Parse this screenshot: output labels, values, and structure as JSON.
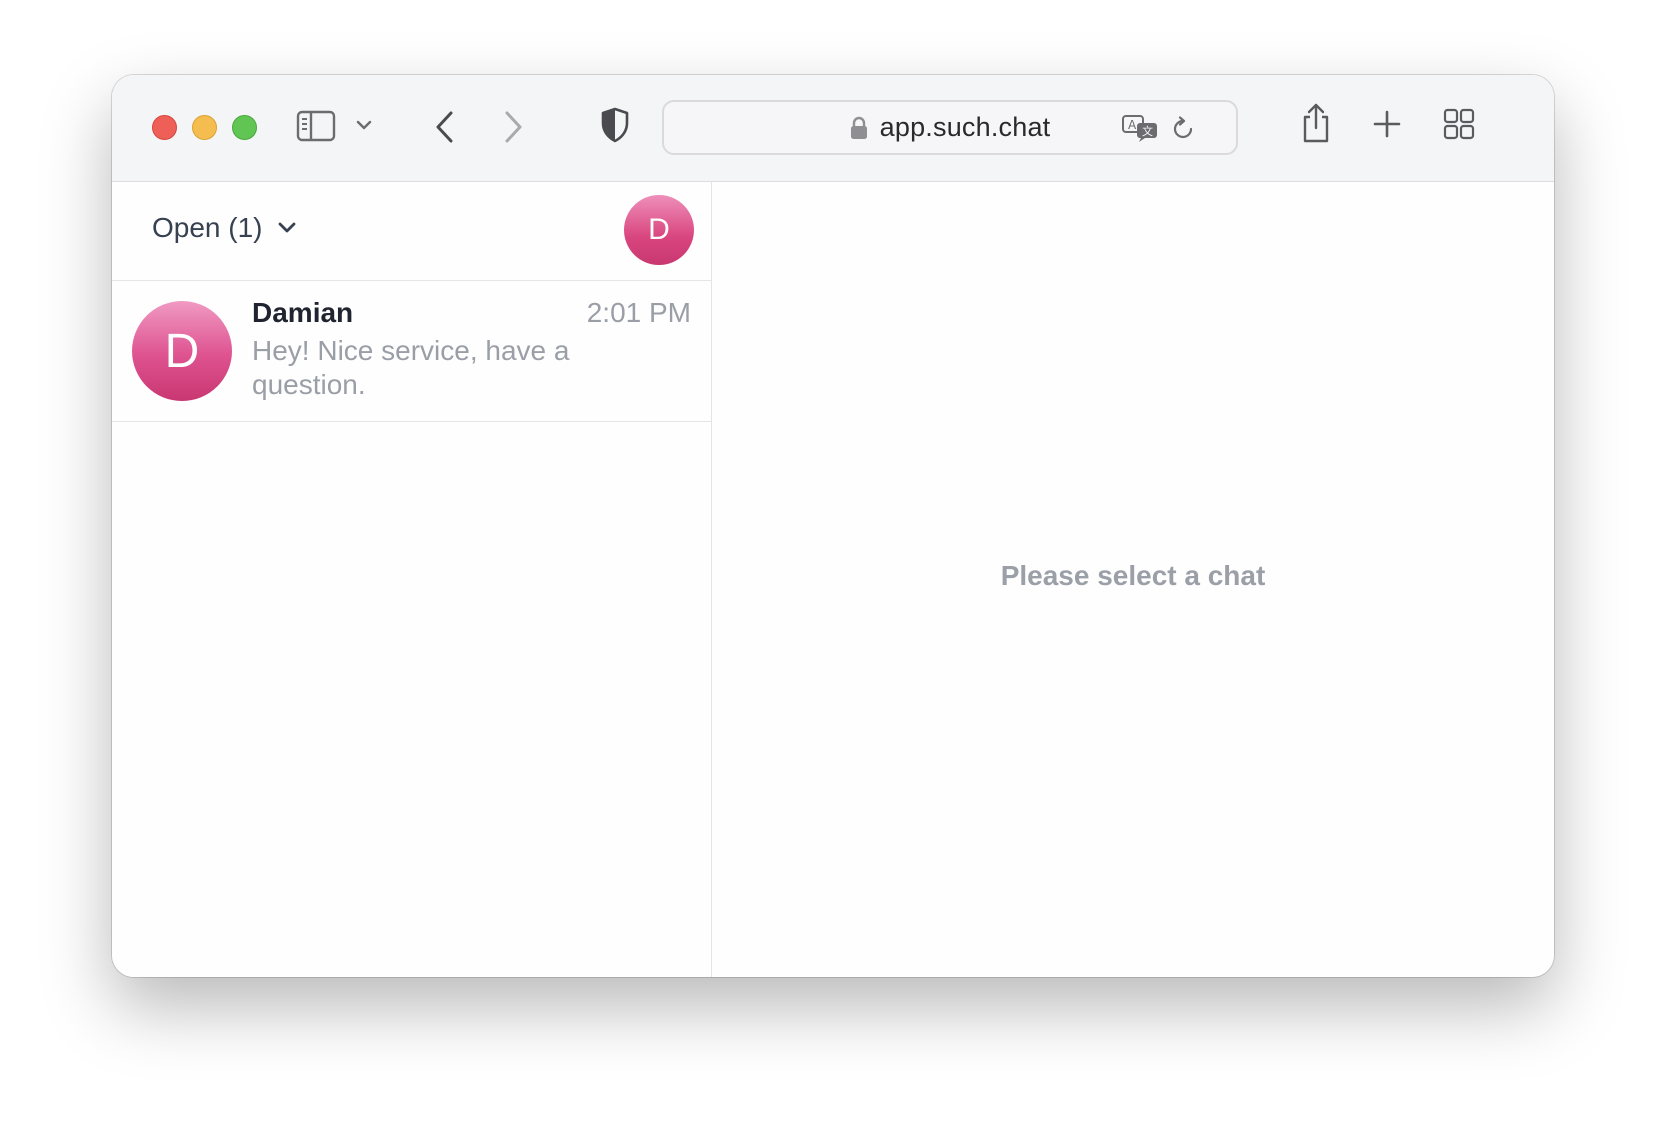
{
  "browser": {
    "url": "app.such.chat",
    "icons": [
      "sidebar-toggle-icon",
      "chevron-down-icon",
      "back-arrow-icon",
      "forward-arrow-icon",
      "shield-icon",
      "lock-icon",
      "translate-icon",
      "reload-icon",
      "share-icon",
      "plus-icon",
      "tab-overview-icon"
    ]
  },
  "sidebar": {
    "filter_label": "Open (1)",
    "user_avatar_initial": "D",
    "chats": [
      {
        "avatar_initial": "D",
        "name": "Damian",
        "time": "2:01 PM",
        "preview": "Hey! Nice service, have a question."
      }
    ]
  },
  "main": {
    "empty_state": "Please select a chat"
  },
  "colors": {
    "avatar_pink": "#d9467f",
    "muted_text": "#9a9ea6",
    "primary_text": "#1f2430"
  }
}
